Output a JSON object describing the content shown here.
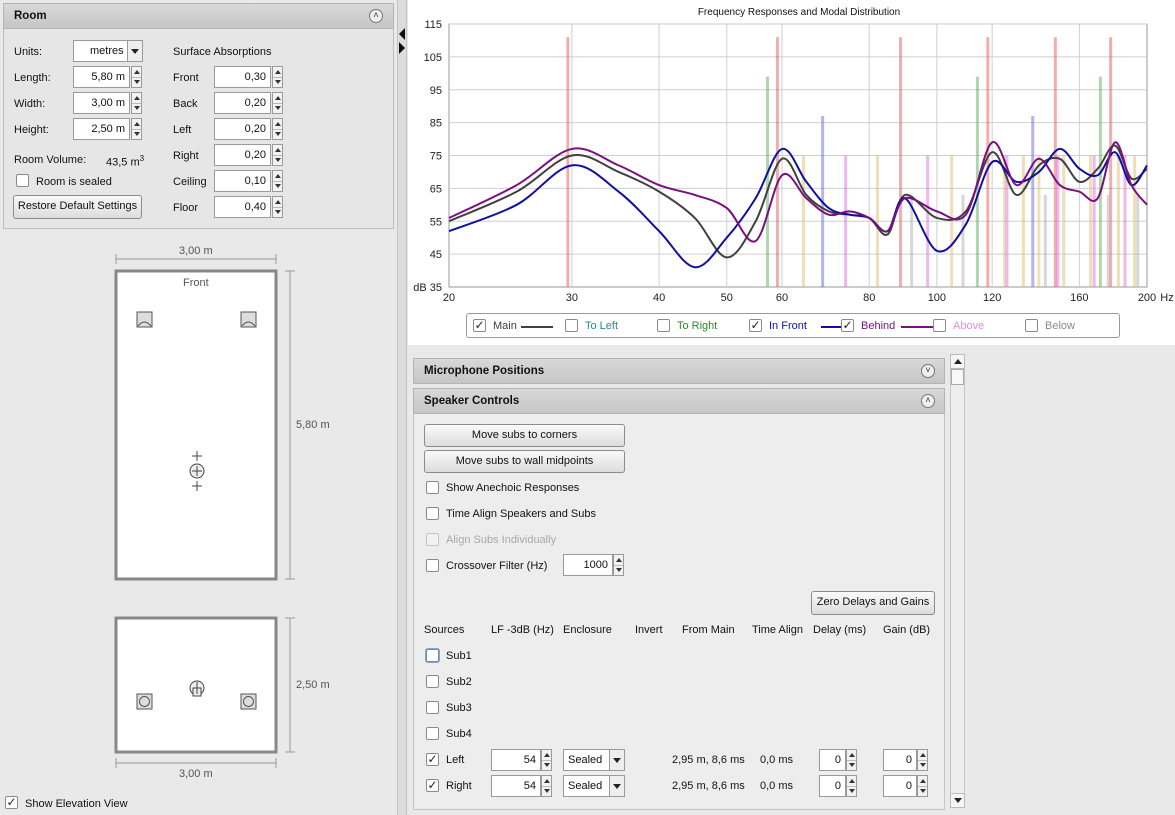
{
  "room": {
    "title": "Room",
    "units_label": "Units:",
    "units_value": "metres",
    "length_label": "Length:",
    "length_value": "5,80 m",
    "width_label": "Width:",
    "width_value": "3,00 m",
    "height_label": "Height:",
    "height_value": "2,50 m",
    "volume_label": "Room Volume:",
    "volume_value": "43,5 m",
    "volume_unit_sup": "3",
    "sealed_label": "Room is sealed",
    "sealed_checked": false,
    "restore_label": "Restore Default Settings",
    "absorptions_title": "Surface Absorptions",
    "absorptions": [
      {
        "label": "Front",
        "value": "0,30"
      },
      {
        "label": "Back",
        "value": "0,20"
      },
      {
        "label": "Left",
        "value": "0,20"
      },
      {
        "label": "Right",
        "value": "0,20"
      },
      {
        "label": "Ceiling",
        "value": "0,10"
      },
      {
        "label": "Floor",
        "value": "0,40"
      }
    ]
  },
  "plan_view": {
    "top_width": "3,00 m",
    "front_label": "Front",
    "side_length": "5,80 m"
  },
  "elevation_view": {
    "side_height": "2,50 m",
    "bottom_width": "3,00 m",
    "show_label": "Show Elevation View",
    "show_checked": true
  },
  "graph": {
    "title": "Frequency Responses and Modal Distribution",
    "y_unit": "dB",
    "x_unit": "Hz",
    "y_ticks": [
      "115",
      "105",
      "95",
      "85",
      "75",
      "65",
      "55",
      "45",
      "35"
    ],
    "x_ticks": [
      "20",
      "30",
      "40",
      "50",
      "60",
      "80",
      "100",
      "120",
      "160",
      "200"
    ],
    "legend": [
      {
        "label": "Main",
        "checked": true,
        "color": "#404040",
        "line": true
      },
      {
        "label": "To Left",
        "checked": false,
        "color": "#2a8a8a",
        "line": false
      },
      {
        "label": "To Right",
        "checked": false,
        "color": "#2a8a2a",
        "line": false
      },
      {
        "label": "In Front",
        "checked": true,
        "color": "#1010a0",
        "line": true
      },
      {
        "label": "Behind",
        "checked": true,
        "color": "#7a1080",
        "line": true
      },
      {
        "label": "Above",
        "checked": false,
        "color": "#e090e0",
        "line": false
      },
      {
        "label": "Below",
        "checked": false,
        "color": "#8a8a8a",
        "line": false
      }
    ]
  },
  "chart_data": {
    "type": "line",
    "title": "Frequency Responses and Modal Distribution",
    "xlabel": "Hz",
    "ylabel": "dB",
    "x_scale": "log",
    "xlim": [
      20,
      200
    ],
    "ylim": [
      35,
      115
    ],
    "grid": true,
    "series": [
      {
        "name": "Main",
        "color": "#404040",
        "points": [
          [
            20,
            55
          ],
          [
            25,
            64
          ],
          [
            30,
            75
          ],
          [
            35,
            70
          ],
          [
            40,
            64
          ],
          [
            45,
            56
          ],
          [
            50,
            44
          ],
          [
            55,
            55
          ],
          [
            60,
            74
          ],
          [
            65,
            63
          ],
          [
            70,
            58
          ],
          [
            75,
            57
          ],
          [
            80,
            56
          ],
          [
            85,
            51
          ],
          [
            90,
            63
          ],
          [
            100,
            56
          ],
          [
            110,
            58
          ],
          [
            120,
            76
          ],
          [
            130,
            63
          ],
          [
            140,
            72
          ],
          [
            150,
            74
          ],
          [
            160,
            67
          ],
          [
            170,
            71
          ],
          [
            180,
            78
          ],
          [
            190,
            68
          ],
          [
            200,
            71
          ]
        ]
      },
      {
        "name": "In Front",
        "color": "#1010a0",
        "points": [
          [
            20,
            52
          ],
          [
            25,
            60
          ],
          [
            30,
            72
          ],
          [
            35,
            64
          ],
          [
            40,
            52
          ],
          [
            45,
            41
          ],
          [
            50,
            50
          ],
          [
            55,
            62
          ],
          [
            60,
            77
          ],
          [
            65,
            67
          ],
          [
            70,
            59
          ],
          [
            75,
            57
          ],
          [
            80,
            56
          ],
          [
            85,
            52
          ],
          [
            90,
            62
          ],
          [
            100,
            46
          ],
          [
            110,
            54
          ],
          [
            120,
            73
          ],
          [
            130,
            67
          ],
          [
            140,
            70
          ],
          [
            150,
            77
          ],
          [
            160,
            71
          ],
          [
            170,
            69
          ],
          [
            180,
            76
          ],
          [
            190,
            66
          ],
          [
            200,
            72
          ]
        ]
      },
      {
        "name": "Behind",
        "color": "#7a1080",
        "points": [
          [
            20,
            56
          ],
          [
            25,
            66
          ],
          [
            30,
            77
          ],
          [
            35,
            72
          ],
          [
            40,
            66
          ],
          [
            45,
            63
          ],
          [
            50,
            59
          ],
          [
            55,
            49
          ],
          [
            60,
            69
          ],
          [
            65,
            62
          ],
          [
            70,
            57
          ],
          [
            75,
            58
          ],
          [
            80,
            56
          ],
          [
            85,
            52
          ],
          [
            90,
            62
          ],
          [
            100,
            58
          ],
          [
            110,
            57
          ],
          [
            120,
            79
          ],
          [
            130,
            66
          ],
          [
            140,
            74
          ],
          [
            150,
            66
          ],
          [
            160,
            64
          ],
          [
            170,
            62
          ],
          [
            180,
            79
          ],
          [
            190,
            66
          ],
          [
            200,
            60
          ]
        ]
      }
    ],
    "modes": {
      "red": [
        29.6,
        59.1,
        88.7,
        118.3,
        147.8,
        177.4
      ],
      "green": [
        57.2,
        114.3,
        171.5
      ],
      "blue": [
        68.6,
        137.2
      ],
      "tan": [
        64.4,
        82.2,
        105,
        125,
        133,
        140,
        152,
        166,
        182,
        192
      ],
      "magenta": [
        74,
        97,
        126,
        149,
        168,
        186
      ],
      "grey": [
        92,
        109,
        143,
        176,
        194
      ]
    }
  },
  "mic_positions": {
    "title": "Microphone Positions"
  },
  "speaker_controls": {
    "title": "Speaker Controls",
    "move_corners_label": "Move subs to corners",
    "move_midpoints_label": "Move subs to wall midpoints",
    "anechoic_label": "Show Anechoic Responses",
    "time_align_label": "Time Align Speakers and Subs",
    "align_subs_label": "Align Subs Individually",
    "crossover_label": "Crossover Filter (Hz)",
    "crossover_value": "1000",
    "zero_label": "Zero Delays and Gains",
    "columns": [
      "Sources",
      "LF -3dB (Hz)",
      "Enclosure",
      "Invert",
      "From Main",
      "Time Align",
      "Delay (ms)",
      "Gain (dB)"
    ],
    "subs": [
      "Sub1",
      "Sub2",
      "Sub3",
      "Sub4"
    ],
    "sources": [
      {
        "name": "Left",
        "checked": true,
        "lf": "54",
        "enclosure": "Sealed",
        "from_main": "2,95 m, 8,6 ms",
        "time_align": "0,0 ms",
        "delay": "0",
        "gain": "0"
      },
      {
        "name": "Right",
        "checked": true,
        "lf": "54",
        "enclosure": "Sealed",
        "from_main": "2,95 m, 8,6 ms",
        "time_align": "0,0 ms",
        "delay": "0",
        "gain": "0"
      }
    ]
  }
}
